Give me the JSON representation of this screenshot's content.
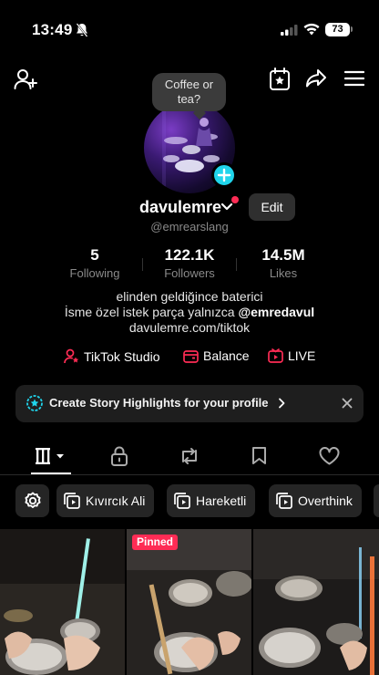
{
  "status_bar": {
    "time": "13:49",
    "battery": "73"
  },
  "profile": {
    "note": "Coffee or tea?",
    "username": "davulemre",
    "edit_label": "Edit",
    "handle": "@emrearslang"
  },
  "stats": [
    {
      "value": "5",
      "label": "Following"
    },
    {
      "value": "122.1K",
      "label": "Followers"
    },
    {
      "value": "14.5M",
      "label": "Likes"
    }
  ],
  "bio": {
    "line1": "elinden geldiğince baterici",
    "line2_prefix": "İsme özel istek parça yalnızca ",
    "line2_mention": "@emredavul",
    "link": "davulemre.com/tiktok"
  },
  "quick_links": {
    "studio": "TikTok Studio",
    "balance": "Balance",
    "live": "LIVE"
  },
  "banner": {
    "text": "Create Story Highlights for your profile"
  },
  "chips": {
    "c1": "Kıvırcık Ali",
    "c2": "Hareketli",
    "c3": "Overthink"
  },
  "videos": {
    "pinned_label": "Pinned"
  },
  "colors": {
    "accent_red": "#fe2c55",
    "accent_cyan": "#20d5ec",
    "background": "#000000"
  }
}
